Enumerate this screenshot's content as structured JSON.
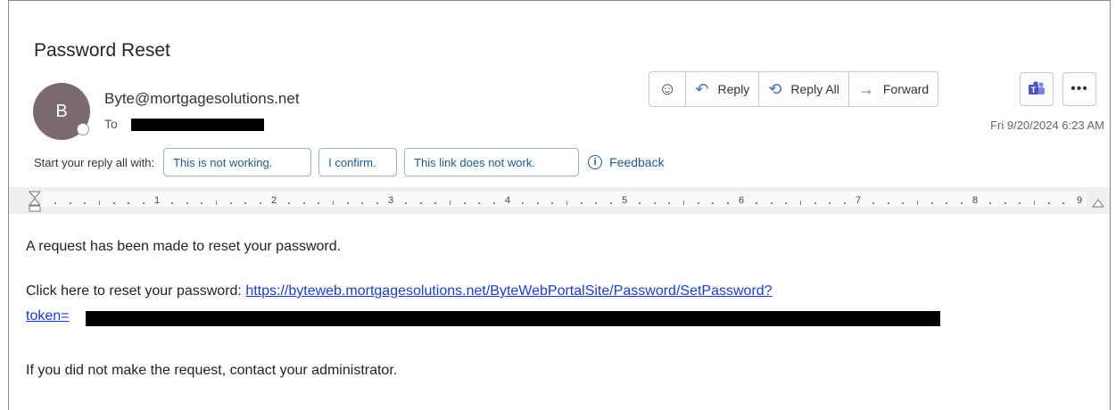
{
  "email": {
    "subject": "Password Reset",
    "avatar_initial": "B",
    "sender": "Byte@mortgagesolutions.net",
    "to_label": "To",
    "date": "Fri 9/20/2024 6:23 AM"
  },
  "actions": {
    "reply": "Reply",
    "reply_all": "Reply All",
    "forward": "Forward"
  },
  "suggested_replies": {
    "label": "Start your reply all with:",
    "chips": [
      "This is not working.",
      "I confirm.",
      "This link does not work."
    ],
    "feedback": "Feedback"
  },
  "ruler": {
    "numbers": [
      "1",
      "2",
      "3",
      "4",
      "5",
      "6",
      "7",
      "8",
      "9"
    ]
  },
  "body": {
    "line1": "A request has been made to reset your password.",
    "line2_prefix": "Click here to reset your password: ",
    "link_part1": "https://byteweb.mortgagesolutions.net/ByteWebPortalSite/Password/SetPassword?",
    "link_part2": "token=",
    "line3": "If you did not make the request, contact your administrator."
  },
  "icons": {
    "emoji": "smiley-icon",
    "reply": "reply-arrow-icon",
    "reply_all": "reply-all-icon",
    "forward": "forward-arrow-icon",
    "teams": "teams-icon",
    "more": "more-icon",
    "feedback": "info-icon"
  },
  "colors": {
    "link": "#1a3ec2",
    "chip_text": "#1f5a8c",
    "avatar_bg": "#7b6a6d",
    "action_icon": "#4a6fb3",
    "teams": "#4b53bc"
  }
}
